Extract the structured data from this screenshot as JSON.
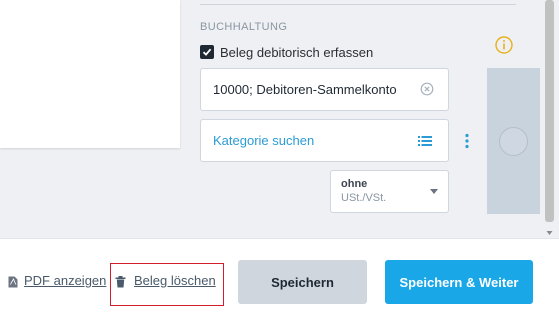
{
  "buchhaltung": {
    "section_label": "BUCHHALTUNG",
    "checkbox_label": "Beleg debitorisch erfassen",
    "checkbox_checked": true,
    "account_value": "10000; Debitoren-Sammelkonto",
    "category_placeholder": "Kategorie suchen",
    "tax_select": {
      "selected_line1": "ohne",
      "selected_line2": "USt./VSt."
    }
  },
  "icons": {
    "info": "info-circle-icon",
    "clear": "clear-x-circle-icon",
    "list": "list-icon",
    "more": "kebab-vertical-icon",
    "pdf": "pdf-file-icon",
    "trash": "trash-icon"
  },
  "colors": {
    "accent_blue": "#19a7e8",
    "link_blue": "#2b9bd4",
    "info_yellow": "#e8b11c",
    "highlight_red": "#d21f2b"
  },
  "footer": {
    "pdf_label": "PDF anzeigen",
    "delete_label": "Beleg löschen",
    "save_label": "Speichern",
    "save_next_label": "Speichern & Weiter"
  }
}
